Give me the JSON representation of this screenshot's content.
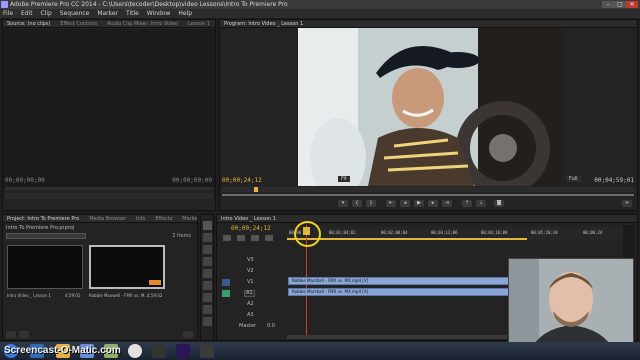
{
  "window": {
    "title": "Adobe Premiere Pro CC 2014 - C:\\Users\\tecoder\\Desktop\\video Lessons\\Intro To Premiere Pro",
    "controls": [
      "–",
      "▢",
      "✕"
    ]
  },
  "menu": [
    "File",
    "Edit",
    "Clip",
    "Sequence",
    "Marker",
    "Title",
    "Window",
    "Help"
  ],
  "source_panel": {
    "tabs": [
      "Source: (no clips)",
      "Effect Controls",
      "Audio Clip Mixer: Intro Video",
      "Lesson 1"
    ],
    "timecode_left": "00;00;00;00",
    "timecode_right": "00;00;00;00"
  },
  "program_panel": {
    "tab": "Program: Intro Video _ Lesson 1",
    "timecode_left": "00;00;24;12",
    "fit": "Fit",
    "quality": "Full",
    "timecode_right": "00;04;59;01"
  },
  "project_panel": {
    "tabs": [
      "Project: Intro To Premiere Pro",
      "Media Browser",
      "Info",
      "Effects",
      "Markers"
    ],
    "project_file": "Intro To Premiere Pro.prproj",
    "items_count": "2 Items",
    "items": [
      {
        "name": "Intro Video _ Lesson 1",
        "duration": "4;59;01"
      },
      {
        "name": "Robbie Maxwell - FMX vs. M...",
        "duration": "4;59;02"
      }
    ]
  },
  "timeline": {
    "tab": "Intro Video _ Lesson 1",
    "timecode": "00;00;24;12",
    "ruler": [
      "00;00",
      "00;01;04;02",
      "00;02;08;04",
      "00;03;12;06",
      "00;04;16;08",
      "00;05;20;10",
      "00;06;24"
    ],
    "video_tracks": [
      "V3",
      "V2",
      "V1"
    ],
    "audio_tracks": [
      "A1",
      "A2",
      "A3"
    ],
    "master_label": "Master",
    "master_value": "0.0",
    "video_clip": "Robbie Marshall - FMX vs. MX.mp4 [V]",
    "audio_clip": "Robbie Marshall - FMX vs. MX.mp4 [A]"
  },
  "taskbar": {
    "watermark": "Screencast-O-Matic.com"
  }
}
